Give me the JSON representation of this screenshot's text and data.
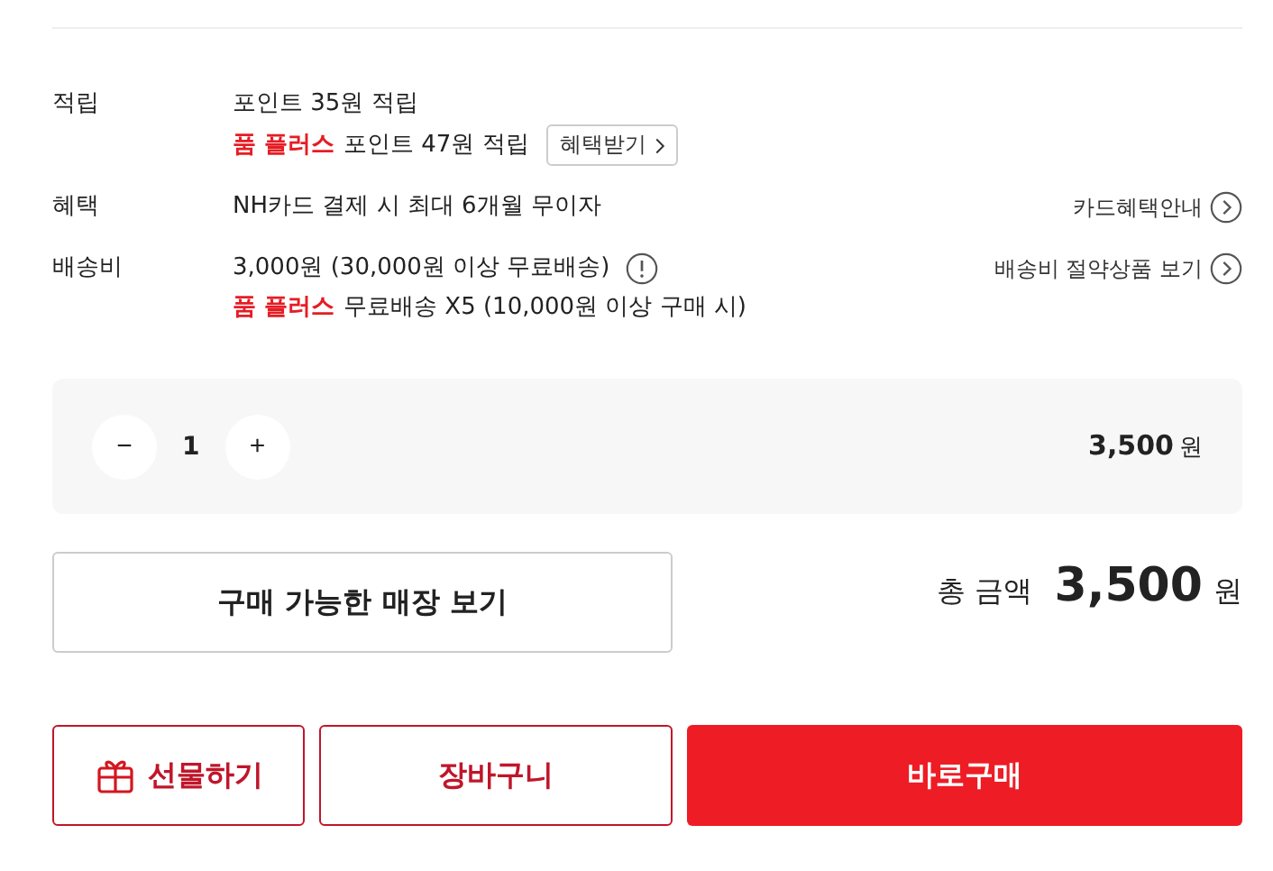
{
  "info_rows": [
    {
      "label": "적립",
      "lines": [
        {
          "text": "포인트 35원 적립",
          "info": false
        },
        {
          "plus_label": "품 플러스",
          "text": "포인트 47원 적립",
          "button": "혜택받기",
          "info": false
        }
      ]
    },
    {
      "label": "혜택",
      "lines": [
        {
          "text": "NH카드 결제 시 최대 6개월 무이자",
          "info": false
        }
      ],
      "link": "카드혜택안내"
    },
    {
      "label": "배송비",
      "lines": [
        {
          "text": "3,000원 (30,000원 이상 무료배송)",
          "info": true
        },
        {
          "plus_label": "품 플러스",
          "text": "무료배송 X5 (10,000원 이상 구매 시)",
          "info": false
        }
      ],
      "link": "배송비 절약상품 보기"
    }
  ],
  "quantity": {
    "minus": "−",
    "value": "1",
    "plus": "+",
    "price": "3,500",
    "unit": "원"
  },
  "store_button": "구매 가능한 매장 보기",
  "total": {
    "label": "총 금액",
    "amount": "3,500",
    "unit": "원"
  },
  "actions": [
    {
      "label": "선물하기",
      "kind": "gift"
    },
    {
      "label": "장바구니",
      "kind": "outline"
    },
    {
      "label": "바로구매",
      "kind": "primary"
    }
  ]
}
